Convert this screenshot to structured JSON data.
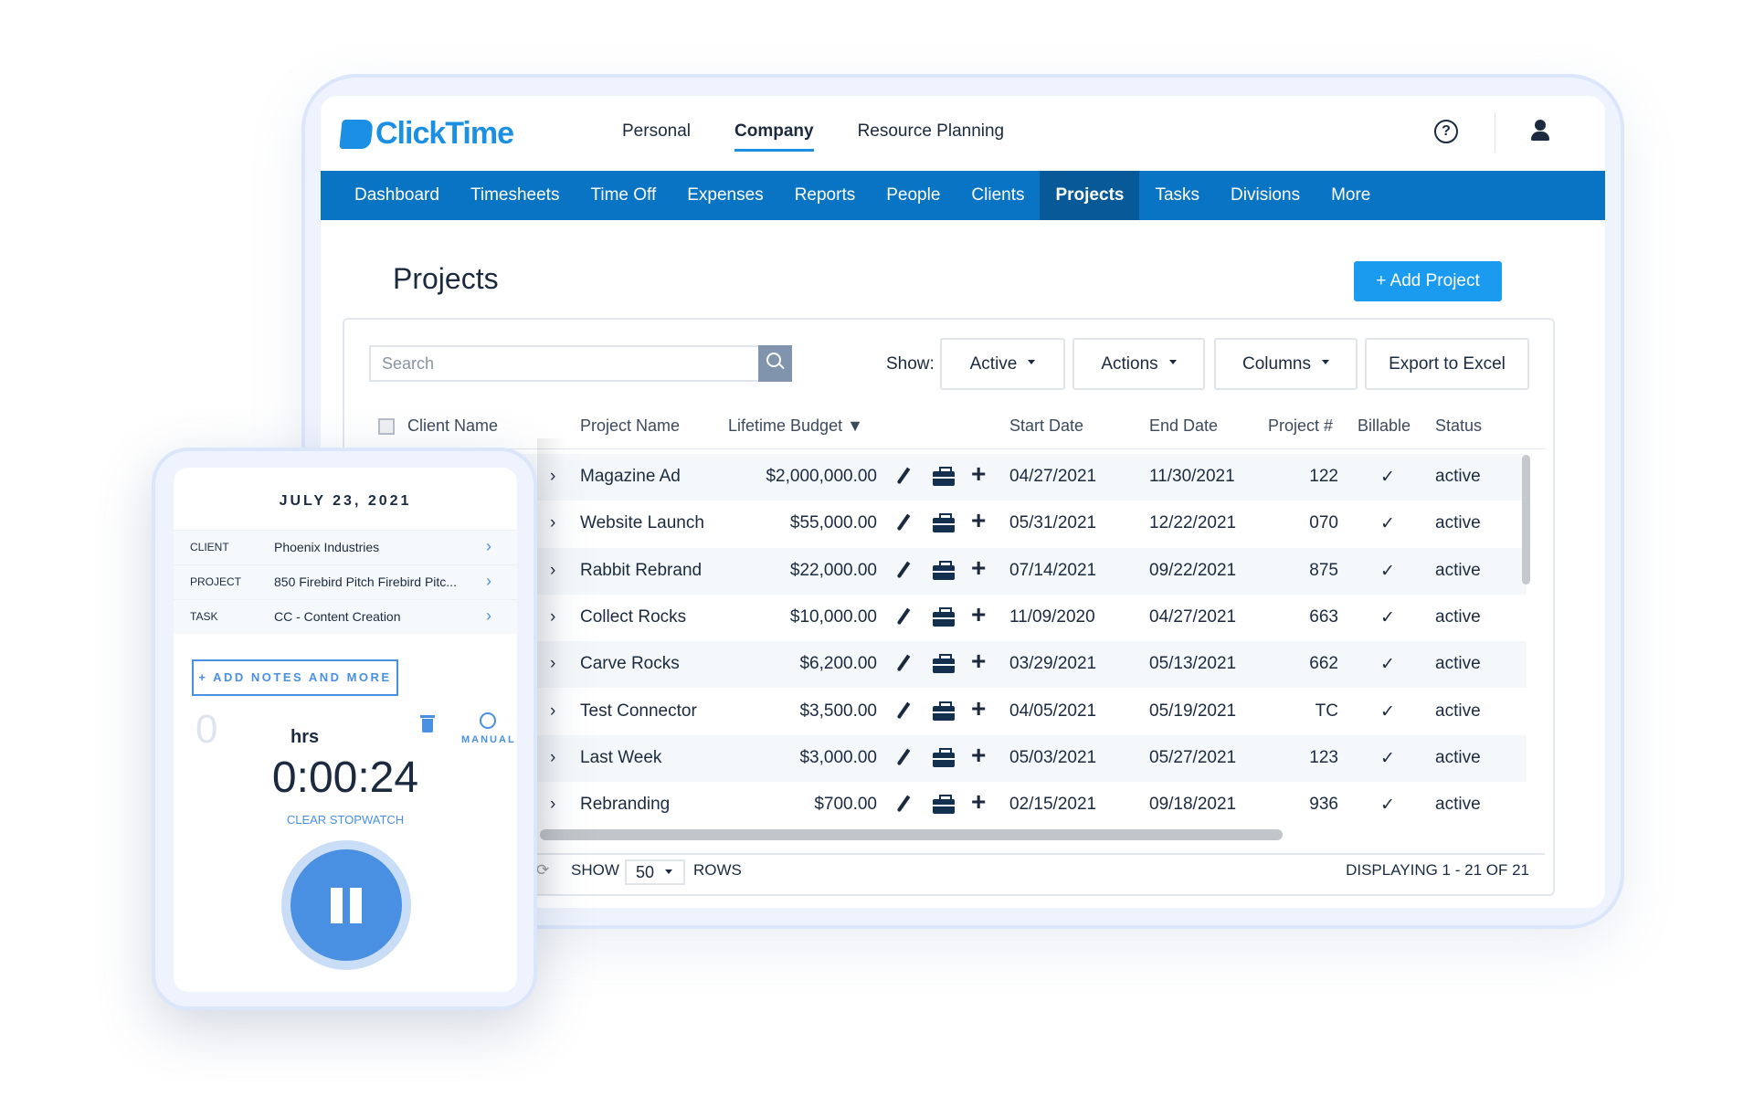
{
  "app": {
    "logo_text": "ClickTime",
    "brand_color": "#1a8fe3"
  },
  "top_nav": [
    {
      "label": "Personal"
    },
    {
      "label": "Company",
      "active": true
    },
    {
      "label": "Resource Planning"
    }
  ],
  "main_nav": [
    {
      "label": "Dashboard"
    },
    {
      "label": "Timesheets"
    },
    {
      "label": "Time Off"
    },
    {
      "label": "Expenses"
    },
    {
      "label": "Reports"
    },
    {
      "label": "People"
    },
    {
      "label": "Clients"
    },
    {
      "label": "Projects",
      "active": true
    },
    {
      "label": "Tasks"
    },
    {
      "label": "Divisions"
    },
    {
      "label": "More"
    }
  ],
  "page": {
    "title": "Projects",
    "add_button": "+ Add Project"
  },
  "toolbar": {
    "search_placeholder": "Search",
    "show_label": "Show:",
    "show_value": "Active",
    "actions": "Actions",
    "columns": "Columns",
    "export": "Export to Excel"
  },
  "table": {
    "headers": {
      "client": "Client Name",
      "project": "Project Name",
      "budget": "Lifetime Budget ▼",
      "start": "Start Date",
      "end": "End Date",
      "num": "Project #",
      "billable": "Billable",
      "status": "Status"
    },
    "rows": [
      {
        "project": "Magazine Ad",
        "budget": "$2,000,000.00",
        "start": "04/27/2021",
        "end": "11/30/2021",
        "num": "122",
        "billable": "✓",
        "status": "active"
      },
      {
        "project": "Website Launch",
        "budget": "$55,000.00",
        "start": "05/31/2021",
        "end": "12/22/2021",
        "num": "070",
        "billable": "✓",
        "status": "active"
      },
      {
        "project": "Rabbit Rebrand",
        "budget": "$22,000.00",
        "start": "07/14/2021",
        "end": "09/22/2021",
        "num": "875",
        "billable": "✓",
        "status": "active"
      },
      {
        "project": "Collect Rocks",
        "budget": "$10,000.00",
        "start": "11/09/2020",
        "end": "04/27/2021",
        "num": "663",
        "billable": "✓",
        "status": "active"
      },
      {
        "project": "Carve Rocks",
        "budget": "$6,200.00",
        "start": "03/29/2021",
        "end": "05/13/2021",
        "num": "662",
        "billable": "✓",
        "status": "active"
      },
      {
        "project": "Test Connector",
        "budget": "$3,500.00",
        "start": "04/05/2021",
        "end": "05/19/2021",
        "num": "TC",
        "billable": "✓",
        "status": "active"
      },
      {
        "project": "Last Week",
        "budget": "$3,000.00",
        "start": "05/03/2021",
        "end": "05/27/2021",
        "num": "123",
        "billable": "✓",
        "status": "active"
      },
      {
        "project": "Rebranding",
        "budget": "$700.00",
        "start": "02/15/2021",
        "end": "09/18/2021",
        "num": "936",
        "billable": "✓",
        "status": "active"
      }
    ]
  },
  "footer": {
    "show": "SHOW",
    "rows_value": "50",
    "rows": "ROWS",
    "displaying": "DISPLAYING 1 - 21 OF 21"
  },
  "phone": {
    "date": "JULY 23, 2021",
    "fields": [
      {
        "key": "CLIENT",
        "value": "Phoenix Industries"
      },
      {
        "key": "PROJECT",
        "value": "850 Firebird Pitch Firebird Pitc..."
      },
      {
        "key": "TASK",
        "value": "CC - Content Creation"
      }
    ],
    "add_notes": "+ ADD NOTES AND MORE",
    "hours_value": "0",
    "hours_unit": "hrs",
    "manual": "MANUAL",
    "timer": "0:00:24",
    "clear": "CLEAR STOPWATCH"
  }
}
